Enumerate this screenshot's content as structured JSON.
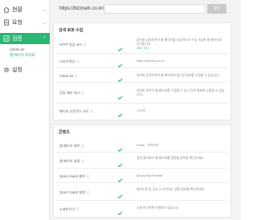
{
  "sidebar": {
    "items": [
      {
        "label": "현황",
        "icon": "home-icon"
      },
      {
        "label": "요청",
        "icon": "document-icon"
      },
      {
        "label": "검증",
        "icon": "check-icon"
      },
      {
        "label": "설정",
        "icon": "gear-icon"
      }
    ],
    "subitems": [
      "robots.txt",
      "웹 페이지 최적화"
    ]
  },
  "header": {
    "url_value": "https://bizmark.co.kr/",
    "button_label": "확인"
  },
  "sections": [
    {
      "title": "검색 로봇 수집",
      "rows": [
        {
          "label": "HTTP 응답 코드 ⓘ",
          "desc": "네이버 검색로봇이 웹 페이지를 성공적으로 수집 가능한 웹 페이지로 인식합니다.",
          "value": "200 : OK"
        },
        {
          "label": "리다이렉션 ⓘ",
          "desc": "https://bizmark.co.kr/",
          "value": ""
        },
        {
          "label": "robots.txt ⓘ",
          "desc": "네이버 검색로봇의 웹 페이지에 접근한 정보를 수집할 수 있습니다.",
          "value": ""
        },
        {
          "label": "검증 메타 태그 ⓘ",
          "desc": "네이버 로봇이 웹 페이지를 수집할 수 있고 검색 결과에 노출될 수 있습니다.",
          "value": ""
        },
        {
          "label": "페이지 다운로드 속도 ⓘ",
          "desc": "1.51초",
          "value": ""
        }
      ]
    },
    {
      "title": "콘텐츠",
      "rows": [
        {
          "label": "웹 페이지 제목 ⓘ",
          "desc": "Home - 비즈마크",
          "value": ""
        },
        {
          "label": "웹 페이지 설명 ⓘ",
          "desc": "검색 결과에서 웹 페이지를 설명할 정보를 확인하세요.",
          "value": ""
        },
        {
          "label": "Open Graph 제목 ⓘ",
          "desc": "Simply But Flexible",
          "value": ""
        },
        {
          "label": "Open Graph 설명 ⓘ",
          "desc": "페이스북 등 공유 시 보여지는 설명 정보를 확인하세요.",
          "value": ""
        },
        {
          "label": "소셜미디어 ⓘ",
          "desc": "소셜 미디어에 연결되어 있습니다.",
          "value": ""
        }
      ]
    }
  ],
  "colors": {
    "accent": "#2bb673",
    "check": "#2bb673",
    "border": "#e8e8e8"
  }
}
